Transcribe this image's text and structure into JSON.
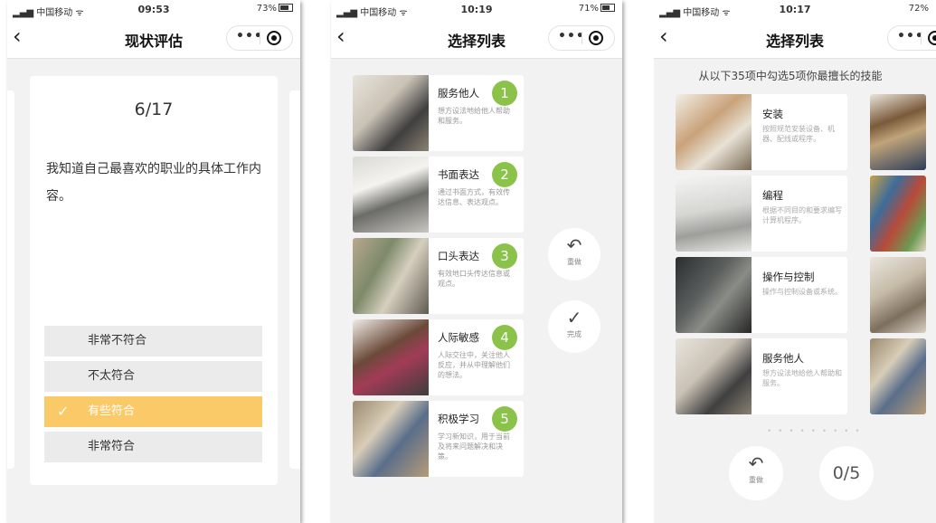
{
  "phone1": {
    "status": {
      "carrier": "中国移动",
      "time": "09:53",
      "battery": "73%"
    },
    "nav": {
      "title": "现状评估",
      "menu_dots": "•••"
    },
    "progress": "6/17",
    "question": "我知道自己最喜欢的职业的具体工作内容。",
    "options": [
      {
        "label": "非常不符合",
        "selected": false
      },
      {
        "label": "不太符合",
        "selected": false
      },
      {
        "label": "有些符合",
        "selected": true
      },
      {
        "label": "非常符合",
        "selected": false
      }
    ],
    "check_glyph": "✓"
  },
  "phone2": {
    "status": {
      "carrier": "中国移动",
      "time": "10:19",
      "battery": "71%"
    },
    "nav": {
      "title": "选择列表",
      "menu_dots": "•••"
    },
    "items": [
      {
        "num": "1",
        "title": "服务他人",
        "desc": "想方设法地给他人帮助和服务。"
      },
      {
        "num": "2",
        "title": "书面表达",
        "desc": "通过书面方式，有效传达信息、表达观点。"
      },
      {
        "num": "3",
        "title": "口头表达",
        "desc": "有效地口头传达信息或观点。"
      },
      {
        "num": "4",
        "title": "人际敏感",
        "desc": "人际交往中，关注他人反应，并从中理解他们的想法。"
      },
      {
        "num": "5",
        "title": "积极学习",
        "desc": "学习新知识，用于当前及将来问题解决和决策。"
      }
    ],
    "undo": {
      "icon": "undo-icon",
      "glyph": "↶",
      "label": "重做"
    },
    "done": {
      "icon": "check-icon",
      "glyph": "✓",
      "label": "完成"
    }
  },
  "phone3": {
    "status": {
      "carrier": "中国移动",
      "time": "10:17",
      "battery": "72%"
    },
    "nav": {
      "title": "选择列表",
      "menu_dots": "•••"
    },
    "subtitle": "从以下35项中勾选5项你最擅长的技能",
    "items": [
      {
        "title": "安装",
        "desc": "按照规范安装设备、机器、配线或程序。"
      },
      {
        "title": "编程",
        "desc": "根据不同目的和要求编写计算机程序。"
      },
      {
        "title": "操作与控制",
        "desc": "操作与控制设备或系统。"
      },
      {
        "title": "服务他人",
        "desc": "想方设法地给他人帮助和服务。"
      }
    ],
    "undo": {
      "icon": "undo-icon",
      "glyph": "↶",
      "label": "重做"
    },
    "counter": "0/5",
    "page_dots": "• • • • • • • • •"
  },
  "icons": {
    "back": "‹",
    "signal": "signal-icon",
    "wifi": "wifi-icon"
  }
}
